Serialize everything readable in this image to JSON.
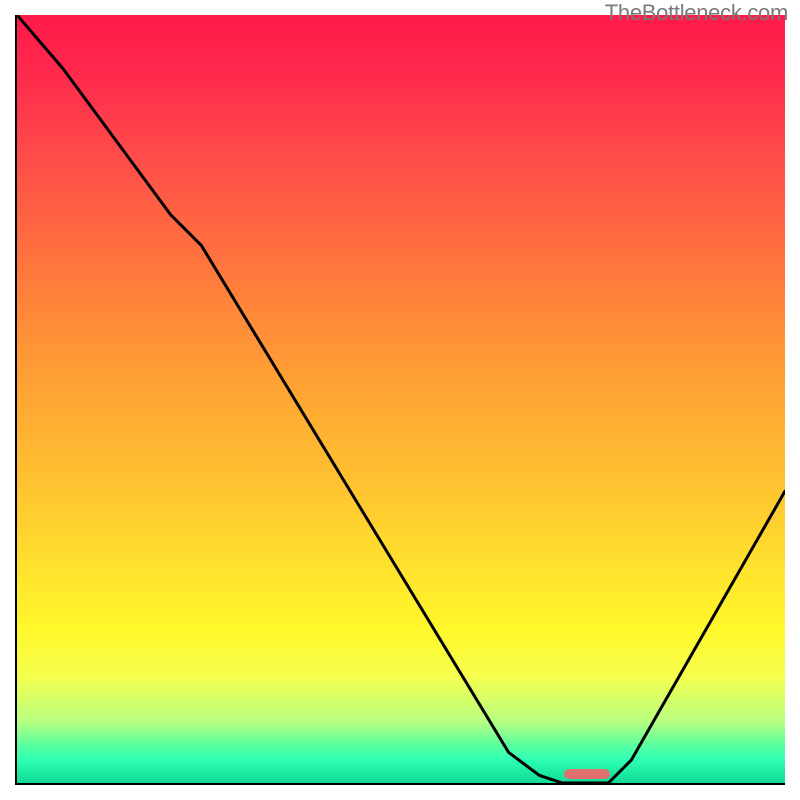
{
  "watermark": "TheBottleneck.com",
  "marker": {
    "x_pct": 71.0,
    "width_pct": 6.0,
    "y_pct": 98.6,
    "color": "#e07070"
  },
  "chart_data": {
    "type": "line",
    "title": "",
    "xlabel": "",
    "ylabel": "",
    "xlim": [
      0,
      100
    ],
    "ylim": [
      0,
      100
    ],
    "grid": false,
    "series": [
      {
        "name": "curve",
        "x": [
          0,
          6,
          20,
          24,
          64,
          68,
          71,
          77,
          80,
          100
        ],
        "values": [
          100,
          93,
          74,
          70,
          4,
          1,
          0,
          0,
          3,
          38
        ]
      }
    ],
    "annotations": [
      {
        "type": "marker",
        "shape": "rounded-rect",
        "x_start": 68,
        "x_end": 77,
        "y": 0,
        "color": "#e07070"
      }
    ],
    "background": {
      "type": "vertical-gradient",
      "stops": [
        {
          "pct": 0,
          "color": "#ff1a49"
        },
        {
          "pct": 18,
          "color": "#ff4b4a"
        },
        {
          "pct": 40,
          "color": "#ff8c38"
        },
        {
          "pct": 62,
          "color": "#ffc530"
        },
        {
          "pct": 80,
          "color": "#fff82a"
        },
        {
          "pct": 92,
          "color": "#b8ff80"
        },
        {
          "pct": 100,
          "color": "#15d896"
        }
      ]
    }
  }
}
